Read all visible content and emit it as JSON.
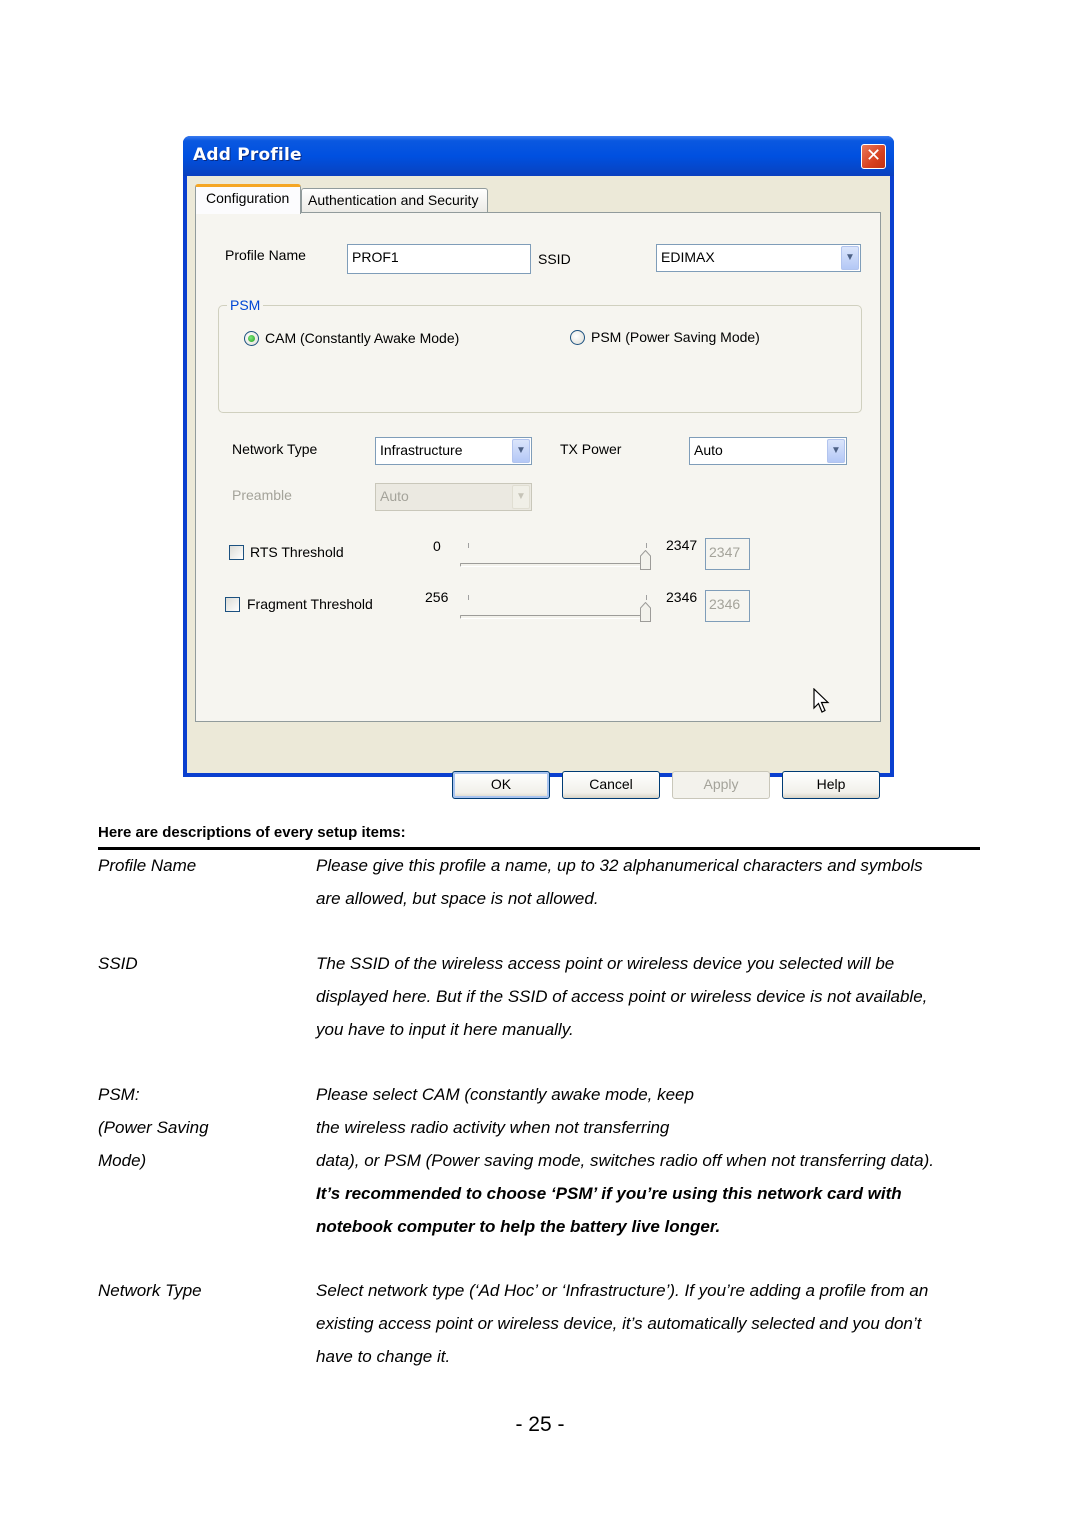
{
  "dialog": {
    "title": "Add Profile",
    "close_glyph": "✕",
    "tabs": [
      {
        "label": "Configuration",
        "active": true
      },
      {
        "label": "Authentication and Security",
        "active": false
      }
    ],
    "profile_name": {
      "label": "Profile Name",
      "value": "PROF1"
    },
    "ssid": {
      "label": "SSID",
      "value": "EDIMAX"
    },
    "psm_group": {
      "legend": "PSM",
      "options": [
        {
          "label": "CAM (Constantly Awake Mode)",
          "selected": true
        },
        {
          "label": "PSM (Power Saving Mode)",
          "selected": false
        }
      ]
    },
    "network_type": {
      "label": "Network Type",
      "value": "Infrastructure"
    },
    "tx_power": {
      "label": "TX Power",
      "value": "Auto"
    },
    "preamble": {
      "label": "Preamble",
      "value": "Auto",
      "disabled": true
    },
    "rts_threshold": {
      "label": "RTS Threshold",
      "checked": false,
      "min": "0",
      "max": "2347",
      "value": "2347"
    },
    "fragment_threshold": {
      "label": "Fragment Threshold",
      "checked": false,
      "min": "256",
      "max": "2346",
      "value": "2346"
    },
    "buttons": {
      "ok": "OK",
      "cancel": "Cancel",
      "apply": "Apply",
      "help": "Help"
    },
    "dropdown_arrow": "▼"
  },
  "doc": {
    "heading": "Here are descriptions of every setup items:",
    "rows": [
      {
        "label": [
          "Profile Name"
        ],
        "text": [
          "Please give this profile a name, up to 32 alphanumerical characters and symbols",
          "are allowed, but space is not allowed."
        ]
      },
      {
        "label": [
          "SSID"
        ],
        "text": [
          "The SSID of the wireless access point or wireless device you selected will be",
          "displayed here. But if the SSID of access point or wireless device is not available,",
          "you have to input it here manually."
        ]
      },
      {
        "label": [
          "PSM:",
          "(Power Saving",
          "Mode)"
        ],
        "text": [
          "Please select CAM (constantly awake mode, keep",
          "the wireless radio activity when not transferring",
          "data), or PSM (Power saving mode, switches radio off when not transferring data)."
        ],
        "bold_text": [
          "It’s recommended to choose ‘PSM’ if you’re using this network card with",
          "notebook computer to help the battery live longer."
        ]
      },
      {
        "label": [
          "Network Type"
        ],
        "text": [
          "Select network type (‘Ad Hoc’ or ‘Infrastructure’). If you’re adding a profile from an",
          "existing access point or wireless device, it’s automatically selected and you don’t",
          "have to change it."
        ]
      }
    ],
    "page_number": "- 25 -"
  }
}
